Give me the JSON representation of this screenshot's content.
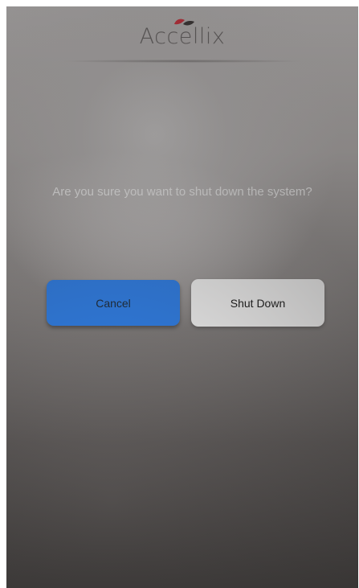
{
  "header": {
    "logo_text": "Accellix",
    "logo_icon": "accellix-logo-icon",
    "logo_colors": {
      "red": "#e0303e",
      "dark": "#3a3535"
    }
  },
  "dialog": {
    "message": "Are you sure you want to shut down the system?",
    "cancel_label": "Cancel",
    "shutdown_label": "Shut Down"
  },
  "colors": {
    "cancel_button": "#2f84f3",
    "shutdown_button": "#ffffff",
    "message_text": "#ffffff"
  }
}
